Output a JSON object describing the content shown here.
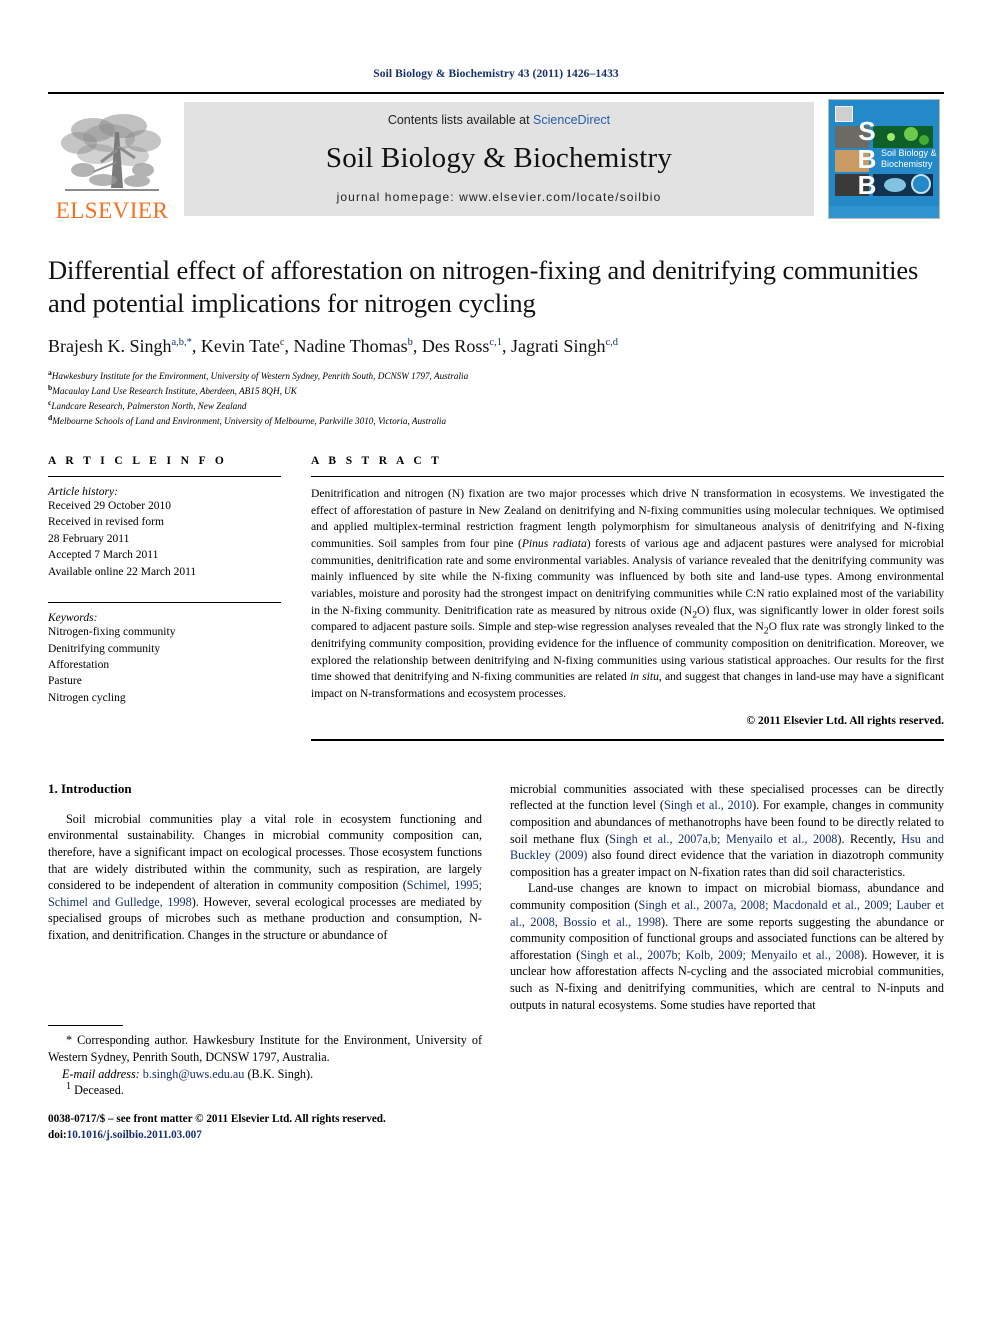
{
  "running_head": "Soil Biology & Biochemistry 43 (2011) 1426–1433",
  "masthead": {
    "publisher_name": "ELSEVIER",
    "contents_prefix": "Contents lists available at ",
    "sciencedirect": "ScienceDirect",
    "journal_title": "Soil Biology & Biochemistry",
    "homepage": "journal homepage: www.elsevier.com/locate/soilbio",
    "cover_letters": [
      "S",
      "B",
      "B"
    ],
    "cover_title_line1": "Soil Biology &",
    "cover_title_line2": "Biochemistry",
    "colors": {
      "elsevier_orange": "#f37021",
      "link_blue": "#2a5caa",
      "ref_blue": "#16306b",
      "masthead_grey": "#e2e2e2",
      "cover_blue": "#2389c8"
    }
  },
  "article": {
    "title": "Differential effect of afforestation on nitrogen-fixing and denitrifying communities and potential implications for nitrogen cycling",
    "authors": [
      {
        "name": "Brajesh K. Singh",
        "sup": "a,b,*"
      },
      {
        "name": "Kevin Tate",
        "sup": "c"
      },
      {
        "name": "Nadine Thomas",
        "sup": "b"
      },
      {
        "name": "Des Ross",
        "sup": "c,1"
      },
      {
        "name": "Jagrati Singh",
        "sup": "c,d"
      }
    ],
    "affiliations": [
      {
        "mark": "a",
        "text": "Hawkesbury Institute for the Environment, University of Western Sydney, Penrith South, DCNSW 1797, Australia"
      },
      {
        "mark": "b",
        "text": "Macaulay Land Use Research Institute, Aberdeen, AB15 8QH, UK"
      },
      {
        "mark": "c",
        "text": "Landcare Research, Palmerston North, New Zealand"
      },
      {
        "mark": "d",
        "text": "Melbourne Schools of Land and Environment, University of Melbourne, Parkville 3010, Victoria, Australia"
      }
    ]
  },
  "article_info": {
    "heading": "A R T I C L E   I N F O",
    "history_label": "Article history:",
    "history": [
      "Received 29 October 2010",
      "Received in revised form",
      "28 February 2011",
      "Accepted 7 March 2011",
      "Available online 22 March 2011"
    ],
    "keywords_label": "Keywords:",
    "keywords": [
      "Nitrogen-fixing community",
      "Denitrifying community",
      "Afforestation",
      "Pasture",
      "Nitrogen cycling"
    ]
  },
  "abstract": {
    "heading": "A B S T R A C T",
    "p1": "Denitrification and nitrogen (N) fixation are two major processes which drive N transformation in ecosystems. We investigated the effect of afforestation of pasture in New Zealand on denitrifying and N-fixing communities using molecular techniques. We optimised and applied multiplex-terminal restriction fragment length polymorphism for simultaneous analysis of denitrifying and N-fixing communities. Soil samples from four pine (",
    "species_italic": "Pinus radiata",
    "p2": ") forests of various age and adjacent pastures were analysed for microbial communities, denitrification rate and some environmental variables. Analysis of variance revealed that the denitrifying community was mainly influenced by site while the N-fixing community was influenced by both site and land-use types. Among environmental variables, moisture and porosity had the strongest impact on denitrifying communities while C:N ratio explained most of the variability in the N-fixing community. Denitrification rate as measured by nitrous oxide (N",
    "sub_2": "2",
    "p3": "O) flux, was significantly lower in older forest soils compared to adjacent pasture soils. Simple and step-wise regression analyses revealed that the N",
    "sub_2b": "2",
    "p4": "O flux rate was strongly linked to the denitrifying community composition, providing evidence for the influence of community composition on denitrification. Moreover, we explored the relationship between denitrifying and N-fixing communities using various statistical approaches. Our results for the first time showed that denitrifying and N-fixing communities are related ",
    "insitu_italic": "in situ",
    "p5": ", and suggest that changes in land-use may have a significant impact on N-transformations and ecosystem processes.",
    "copyright": "© 2011 Elsevier Ltd. All rights reserved."
  },
  "introduction": {
    "heading": "1. Introduction",
    "left_p1_a": "Soil microbial communities play a vital role in ecosystem functioning and environmental sustainability. Changes in microbial community composition can, therefore, have a significant impact on ecological processes. Those ecosystem functions that are widely distributed within the community, such as respiration, are largely considered to be independent of alteration in community composition (",
    "left_ref1": "Schimel, 1995; Schimel and Gulledge, 1998",
    "left_p1_b": "). However, several ecological processes are mediated by specialised groups of microbes such as methane production and consumption, N-fixation, and denitrification. Changes in the structure or abundance of",
    "right_p1_a": "microbial communities associated with these specialised processes can be directly reflected at the function level (",
    "right_ref1": "Singh et al., 2010",
    "right_p1_b": "). For example, changes in community composition and abundances of methanotrophs have been found to be directly related to soil methane flux (",
    "right_ref2": "Singh et al., 2007a,b; Menyailo et al., 2008",
    "right_p1_c": "). Recently, ",
    "right_ref3": "Hsu and Buckley (2009)",
    "right_p1_d": " also found direct evidence that the variation in diazotroph community composition has a greater impact on N-fixation rates than did soil characteristics.",
    "right_p2_a": "Land-use changes are known to impact on microbial biomass, abundance and community composition (",
    "right_ref4": "Singh et al., 2007a, 2008; Macdonald et al., 2009; Lauber et al., 2008, Bossio et al., 1998",
    "right_p2_b": "). There are some reports suggesting the abundance or community composition of functional groups and associated functions can be altered by afforestation (",
    "right_ref5": "Singh et al., 2007b; Kolb, 2009; Menyailo et al., 2008",
    "right_p2_c": "). However, it is unclear how afforestation affects N-cycling and the associated microbial communities, such as N-fixing and denitrifying communities, which are central to N-inputs and outputs in natural ecosystems. Some studies have reported that"
  },
  "footnotes": {
    "corresponding_mark": "*",
    "corresponding_text": " Corresponding author. Hawkesbury Institute for the Environment, University of Western Sydney, Penrith South, DCNSW 1797, Australia.",
    "email_label": "E-mail address:",
    "email_address": "b.singh@uws.edu.au",
    "email_owner": " (B.K. Singh).",
    "deceased_mark": "1",
    "deceased_text": " Deceased."
  },
  "imprint": {
    "issn_line": "0038-0717/$ – see front matter © 2011 Elsevier Ltd. All rights reserved.",
    "doi_label": "doi:",
    "doi_value": "10.1016/j.soilbio.2011.03.007"
  }
}
